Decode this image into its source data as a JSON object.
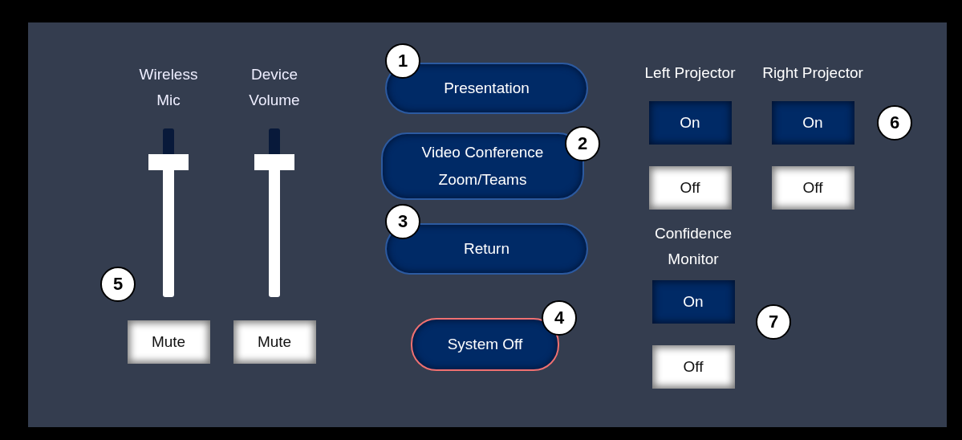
{
  "sliders": [
    {
      "label": "Wireless Mic",
      "level": 0.8,
      "mute_label": "Mute",
      "muted": false,
      "callout": "5"
    },
    {
      "label": "Device Volume",
      "level": 0.8,
      "mute_label": "Mute",
      "muted": false
    }
  ],
  "mode_buttons": [
    {
      "label": "Presentation",
      "kind": "mode",
      "callout": "1"
    },
    {
      "label": "Video Conference Zoom/Teams",
      "kind": "mode",
      "callout": "2"
    },
    {
      "label": "Return",
      "kind": "mode",
      "callout": "3"
    },
    {
      "label": "System Off",
      "kind": "power",
      "callout": "4"
    }
  ],
  "projectors": {
    "callout": "6",
    "items": [
      {
        "label": "Left Projector",
        "buttons": [
          {
            "label": "On",
            "selected": true
          },
          {
            "label": "Off",
            "selected": false
          }
        ]
      },
      {
        "label": "Right Projector",
        "buttons": [
          {
            "label": "On",
            "selected": true
          },
          {
            "label": "Off",
            "selected": false
          }
        ]
      }
    ]
  },
  "confidence_monitor": {
    "label": "Confidence Monitor",
    "callout": "7",
    "buttons": [
      {
        "label": "On",
        "selected": true
      },
      {
        "label": "Off",
        "selected": false
      }
    ]
  }
}
